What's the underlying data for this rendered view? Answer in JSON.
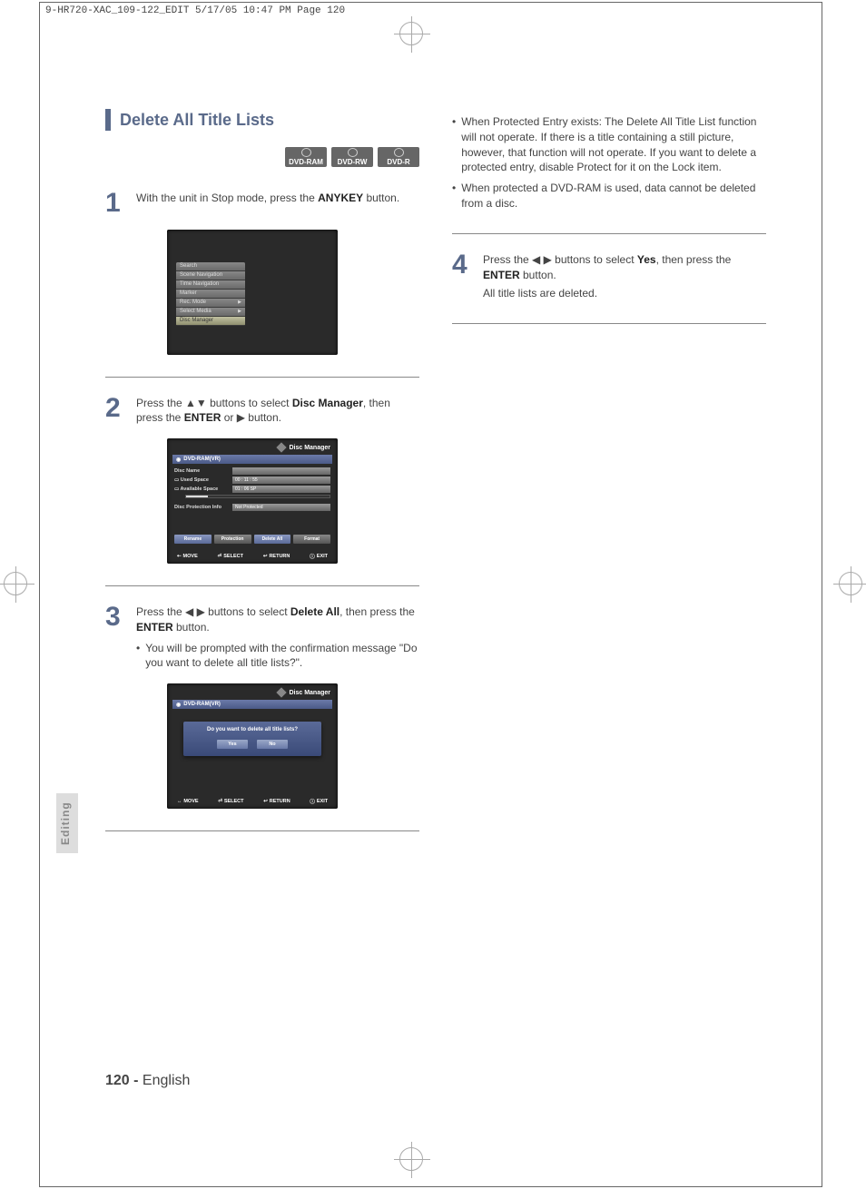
{
  "meta": {
    "header": "9-HR720-XAC_109-122_EDIT  5/17/05  10:47 PM  Page 120"
  },
  "section_tab": "Editing",
  "title": "Delete All Title Lists",
  "disc_badges": [
    "DVD-RAM",
    "DVD-RW",
    "DVD-R"
  ],
  "step1": {
    "num": "1",
    "text_a": "With the unit in Stop mode, press the ",
    "text_b": "ANYKEY",
    "text_c": " button."
  },
  "osd1_menu": [
    "Search",
    "Scene Navigation",
    "Time Navigation",
    "Marker",
    "Rec. Mode",
    "Select Media",
    "Disc Manager"
  ],
  "osd1_arrow_indices": [
    4,
    5
  ],
  "step2": {
    "num": "2",
    "text_a": "Press the ▲▼ buttons to select ",
    "text_b": "Disc Manager",
    "text_c": ", then press the ",
    "text_d": "ENTER",
    "text_e": " or ▶ button."
  },
  "osd2": {
    "title": "Disc Manager",
    "sub_icon": "◉",
    "sub": "DVD-RAM(VR)",
    "rows": {
      "disc_name": "Disc Name",
      "used_space_lbl": "Used Space",
      "used_space_val": "00 : 11 : 55",
      "avail_space_lbl": "Available Space",
      "avail_space_val": "01 : 06 SP",
      "prot_lbl": "Disc Protection Info",
      "prot_val": "Not Protected"
    },
    "buttons": [
      "Rename",
      "Protection",
      "Delete All",
      "Format"
    ],
    "footer": [
      "MOVE",
      "SELECT",
      "RETURN",
      "EXIT"
    ],
    "footer_icons": [
      "⇠",
      "⏎",
      "↩",
      "ⓘ"
    ]
  },
  "step3": {
    "num": "3",
    "text_a": "Press the ◀ ▶ buttons to select ",
    "text_b": "Delete All",
    "text_c": ", then press the ",
    "text_d": "ENTER",
    "text_e": " button.",
    "bullet": "You will be prompted with the confirmation message \"Do you want to delete all title lists?\"."
  },
  "osd3": {
    "title": "Disc Manager",
    "sub": "DVD-RAM(VR)",
    "dialog_text": "Do you want to delete all title lists?",
    "yes": "Yes",
    "no": "No",
    "footer": [
      "MOVE",
      "SELECT",
      "RETURN",
      "EXIT"
    ],
    "footer_icons": [
      "↔",
      "⏎",
      "↩",
      "ⓘ"
    ]
  },
  "right_notes": {
    "b1": "When Protected Entry exists: The Delete All Title List function will not operate. If there is a title containing a still picture, however, that function will not operate. If you want to delete a protected entry, disable Protect for it on the Lock item.",
    "b2": "When protected a DVD-RAM is used, data cannot be deleted from a disc."
  },
  "step4": {
    "num": "4",
    "text_a": "Press the ◀ ▶ buttons to select ",
    "text_b": "Yes",
    "text_c": ", then press the ",
    "text_d": "ENTER",
    "text_e": " button.",
    "line2": "All title lists are deleted."
  },
  "footer": {
    "page": "120 -",
    "lang": "English"
  }
}
